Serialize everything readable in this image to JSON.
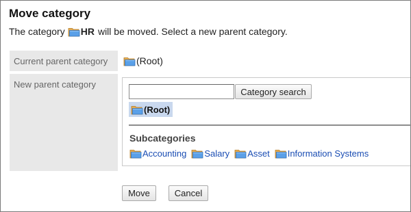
{
  "page": {
    "title": "Move category",
    "description_prefix": "The category",
    "category_name": "HR",
    "description_suffix": "will be moved. Select a new parent category."
  },
  "form": {
    "current_parent_label": "Current parent category",
    "current_parent_value": "(Root)",
    "new_parent_label": "New parent category",
    "search_input_value": "",
    "search_button_label": "Category search",
    "selected_category": "(Root)",
    "subcategories_heading": "Subcategories",
    "subcategories": [
      {
        "label": "Accounting"
      },
      {
        "label": "Salary"
      },
      {
        "label": "Asset"
      },
      {
        "label": "Information Systems"
      }
    ]
  },
  "actions": {
    "move_label": "Move",
    "cancel_label": "Cancel"
  },
  "colors": {
    "label_cell_bg": "#e8e8e8",
    "selected_bg": "#c9d8ee",
    "link": "#1a4db3",
    "folder_front": "#4f8fd8",
    "folder_back": "#e3a44a"
  }
}
